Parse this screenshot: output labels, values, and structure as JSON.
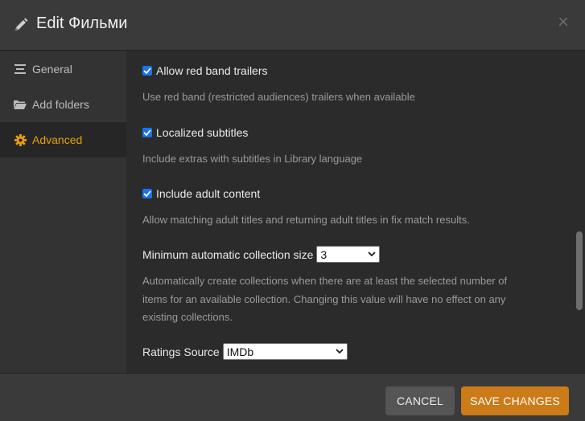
{
  "header": {
    "title": "Edit Фильми",
    "close_symbol": "×"
  },
  "sidebar": {
    "items": [
      {
        "label": "General",
        "icon": "list-icon",
        "active": false
      },
      {
        "label": "Add folders",
        "icon": "folder-icon",
        "active": false
      },
      {
        "label": "Advanced",
        "icon": "gear-icon",
        "active": true
      }
    ]
  },
  "settings": {
    "red_band": {
      "label": "Allow red band trailers",
      "checked": true,
      "description": "Use red band (restricted audiences) trailers when available"
    },
    "subtitles": {
      "label": "Localized subtitles",
      "checked": true,
      "description": "Include extras with subtitles in Library language"
    },
    "adult": {
      "label": "Include adult content",
      "checked": true,
      "description": "Allow matching adult titles and returning adult titles in fix match results."
    },
    "collection_size": {
      "label": "Minimum automatic collection size",
      "value": "3",
      "description_lines": [
        "Automatically create collections when there are at least the selected number of",
        "items for an available collection. Changing this value will have no effect on any",
        "existing collections."
      ]
    },
    "ratings_source": {
      "label": "Ratings Source",
      "value": "IMDb"
    }
  },
  "footer": {
    "cancel_label": "CANCEL",
    "save_label": "SAVE CHANGES"
  },
  "colors": {
    "accent": "#e5a00d",
    "save_button": "#cc7b19",
    "checkbox": "#1a73e8"
  }
}
